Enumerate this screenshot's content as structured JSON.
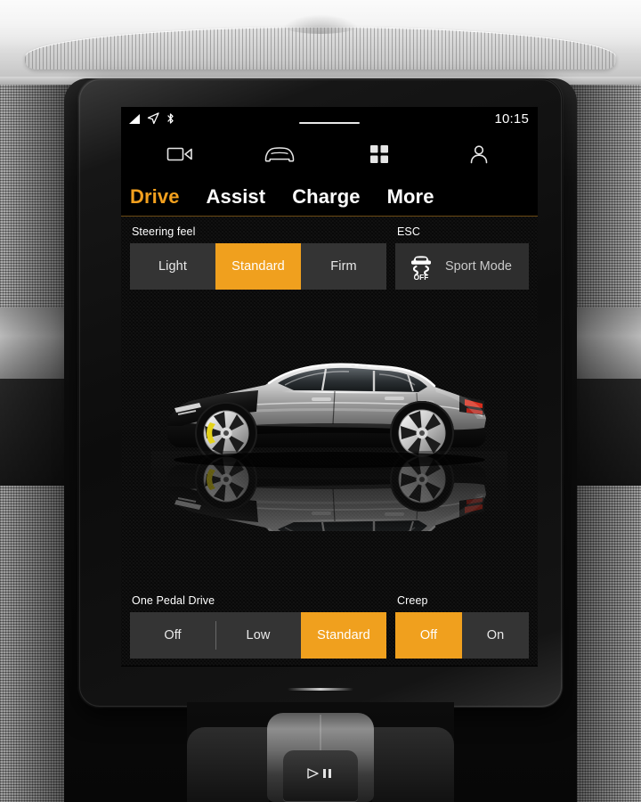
{
  "device": {
    "name": "polestar-center-display",
    "accent_color": "#f0a01e",
    "screen_background": "#080808"
  },
  "statusbar": {
    "signal_icon": "signal-strength-icon",
    "location_icon": "location-arrow-icon",
    "bluetooth_icon": "bluetooth-icon",
    "handle_icon": "drag-handle-pill",
    "time": "10:15"
  },
  "navbar": {
    "items": [
      {
        "icon": "camera-icon",
        "name": "nav-camera"
      },
      {
        "icon": "car-front-icon",
        "name": "nav-car"
      },
      {
        "icon": "apps-grid-icon",
        "name": "nav-apps"
      },
      {
        "icon": "profile-icon",
        "name": "nav-profile"
      }
    ]
  },
  "tabs": [
    {
      "label": "Drive",
      "active": true
    },
    {
      "label": "Assist",
      "active": false
    },
    {
      "label": "Charge",
      "active": false
    },
    {
      "label": "More",
      "active": false
    }
  ],
  "settings": {
    "steering_feel": {
      "label": "Steering feel",
      "options": [
        "Light",
        "Standard",
        "Firm"
      ],
      "selected": "Standard"
    },
    "esc": {
      "label": "ESC",
      "button_label": "Sport Mode",
      "icon": "esc-off-icon",
      "icon_text": "OFF",
      "active": false
    },
    "one_pedal_drive": {
      "label": "One Pedal Drive",
      "options": [
        "Off",
        "Low",
        "Standard"
      ],
      "selected": "Standard"
    },
    "creep": {
      "label": "Creep",
      "options": [
        "Off",
        "On"
      ],
      "selected": "Off"
    }
  },
  "hero": {
    "name": "vehicle-side-view",
    "description": "Polestar 2 side profile on reflective surface"
  },
  "console": {
    "play_pause_icon": "play-pause-icon"
  }
}
